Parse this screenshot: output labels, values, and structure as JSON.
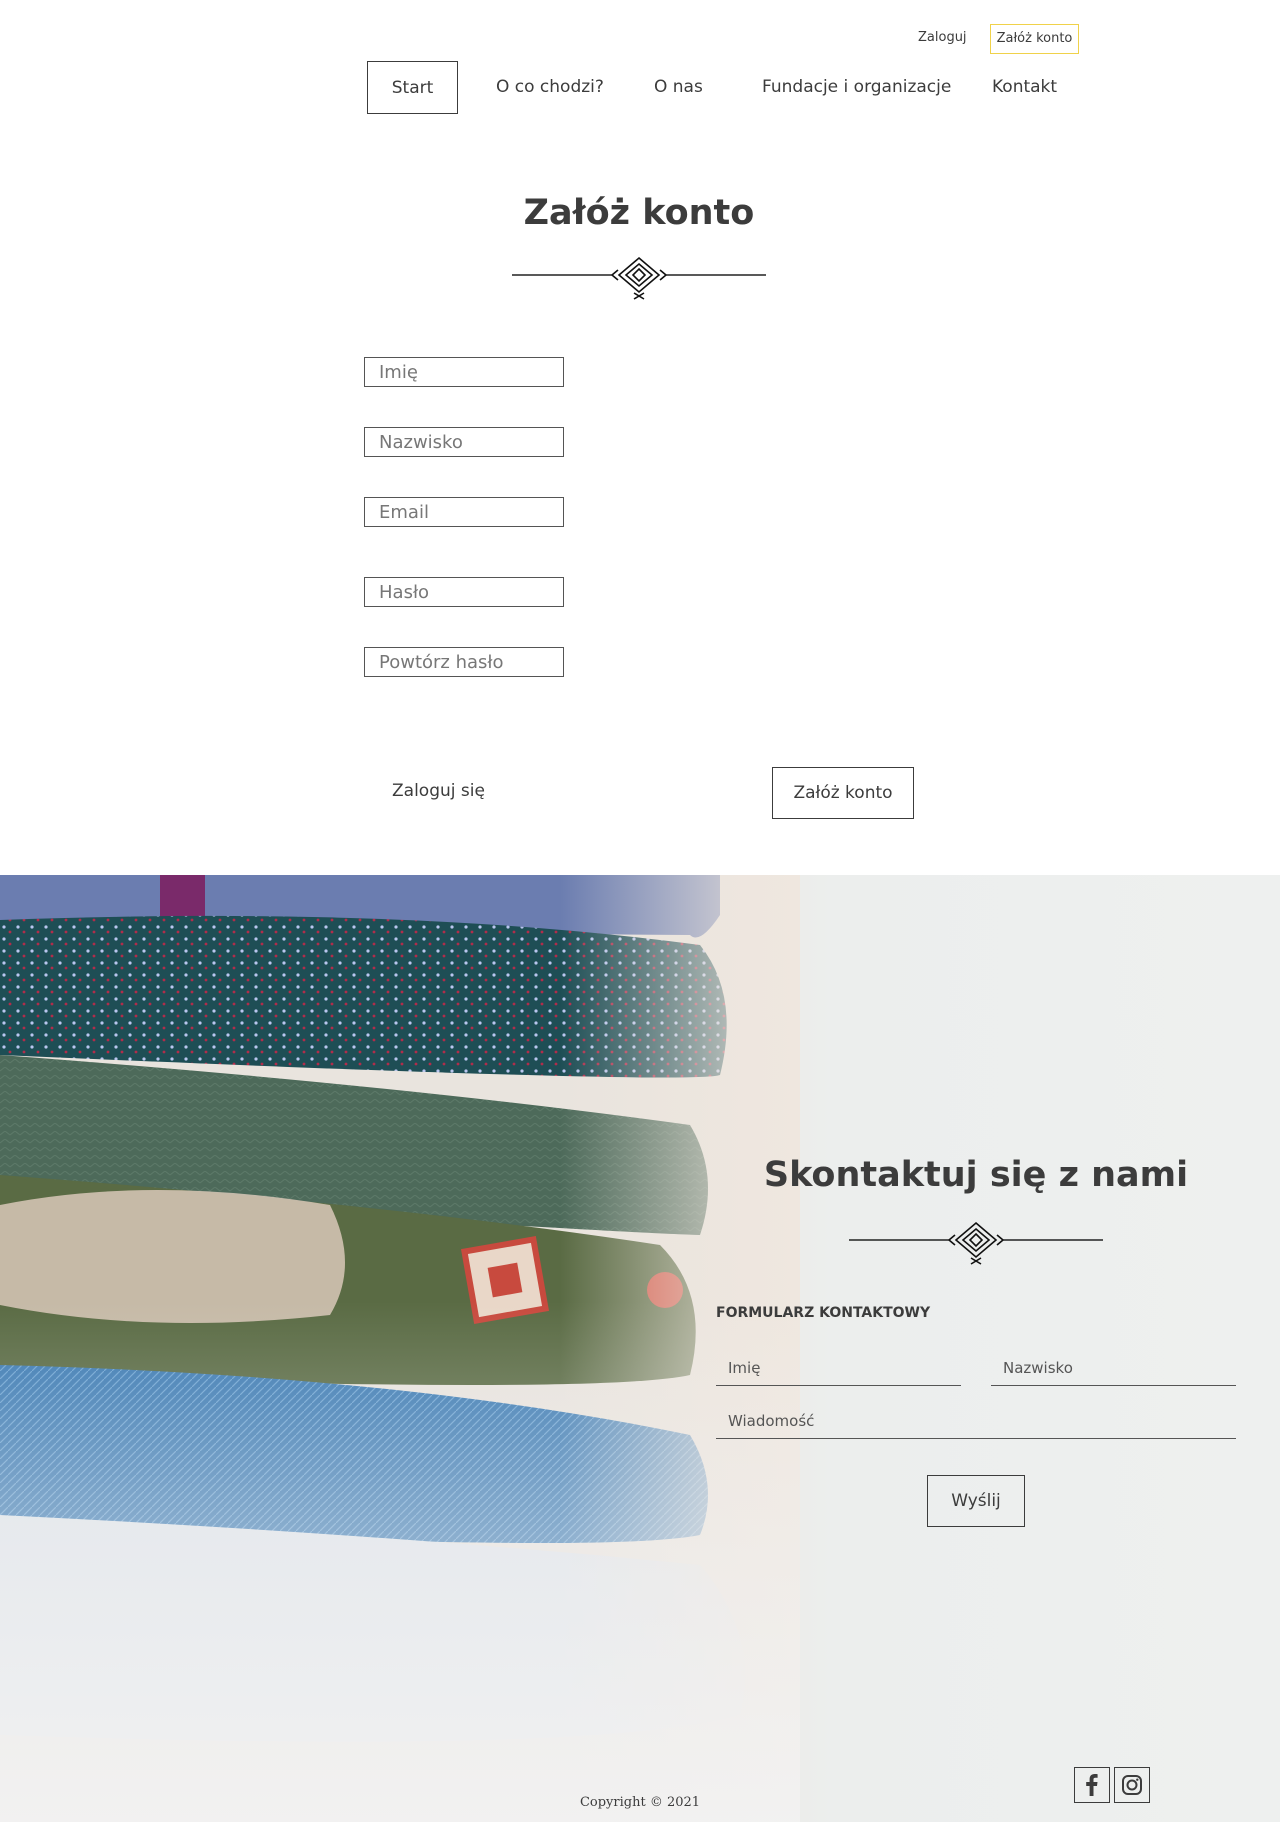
{
  "header": {
    "login_label": "Zaloguj",
    "register_label": "Załóż konto"
  },
  "nav": {
    "items": [
      {
        "label": "Start",
        "active": true
      },
      {
        "label": "O co chodzi?",
        "active": false
      },
      {
        "label": "O nas",
        "active": false
      },
      {
        "label": "Fundacje i organizacje",
        "active": false
      },
      {
        "label": "Kontakt",
        "active": false
      }
    ]
  },
  "register": {
    "title": "Załóż konto",
    "fields": {
      "first_name_placeholder": "Imię",
      "last_name_placeholder": "Nazwisko",
      "email_placeholder": "Email",
      "password_placeholder": "Hasło",
      "password_repeat_placeholder": "Powtórz hasło"
    },
    "login_link": "Zaloguj się",
    "submit_label": "Załóż konto"
  },
  "contact": {
    "title": "Skontaktuj się z nami",
    "form_title": "FORMULARZ KONTAKTOWY",
    "first_name_placeholder": "Imię",
    "last_name_placeholder": "Nazwisko",
    "message_placeholder": "Wiadomość",
    "send_label": "Wyślij"
  },
  "footer": {
    "copyright": "Copyright © 2021",
    "social": [
      "facebook-icon",
      "instagram-icon"
    ]
  },
  "colors": {
    "accent_border": "#f0d24a",
    "text": "#3c3c3c"
  }
}
